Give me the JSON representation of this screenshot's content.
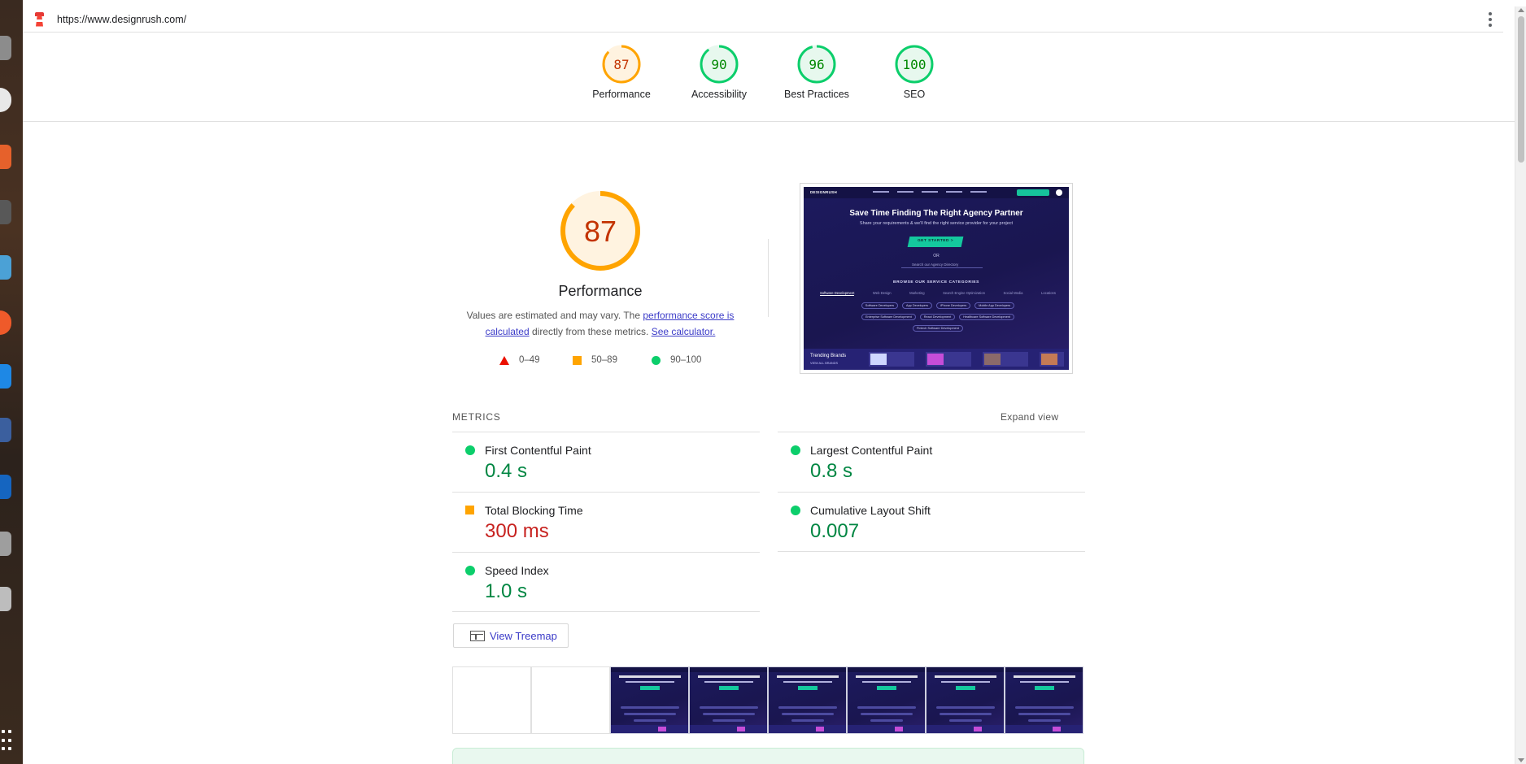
{
  "browser": {
    "url": "https://www.designrush.com/"
  },
  "categories": [
    {
      "name": "Performance",
      "score": 87,
      "color": "#ffa400",
      "text_color": "#c33300"
    },
    {
      "name": "Accessibility",
      "score": 90,
      "color": "#0cce6b",
      "text_color": "#008800"
    },
    {
      "name": "Best Practices",
      "score": 96,
      "color": "#0cce6b",
      "text_color": "#008800"
    },
    {
      "name": "SEO",
      "score": 100,
      "color": "#0cce6b",
      "text_color": "#008800"
    }
  ],
  "performance": {
    "score": 87,
    "title": "Performance",
    "desc_prefix": "Values are estimated and may vary. The ",
    "desc_link1": "performance score is calculated",
    "desc_middle": " directly from these metrics. ",
    "desc_link2": "See calculator.",
    "legend": [
      {
        "shape": "triangle",
        "range": "0–49",
        "color": "#eb0f00"
      },
      {
        "shape": "square",
        "range": "50–89",
        "color": "#ffa400"
      },
      {
        "shape": "circle",
        "range": "90–100",
        "color": "#0cce6b"
      }
    ]
  },
  "screenshot": {
    "logo": "DESIGNRUSH",
    "headline": "Save Time Finding The Right Agency Partner",
    "subline": "Share your requirements & we'll find the right service provider for your project",
    "cta": "GET STARTED >",
    "or": "OR",
    "search_placeholder": "Search our Agency Directory",
    "browse": "BROWSE OUR SERVICE CATEGORIES",
    "tabs": [
      "Software Development",
      "Web Design",
      "Marketing",
      "Search Engine Optimization",
      "Social Media",
      "Locations"
    ],
    "chips_row1": [
      "Software Developers",
      "App Developers",
      "iPhone Developers",
      "Mobile App Developers"
    ],
    "chips_row2": [
      "Enterprise Software Development",
      "React Development",
      "Healthcare Software Development"
    ],
    "chips_row3": [
      "Fintech Software Development"
    ],
    "footer_title": "Trending Brands",
    "footer_sub": "VIEW ALL BRANDS"
  },
  "metrics": {
    "label": "METRICS",
    "expand": "Expand view",
    "items": [
      {
        "name": "First Contentful Paint",
        "value": "0.4 s",
        "status": "pass"
      },
      {
        "name": "Largest Contentful Paint",
        "value": "0.8 s",
        "status": "pass"
      },
      {
        "name": "Total Blocking Time",
        "value": "300 ms",
        "status": "average"
      },
      {
        "name": "Cumulative Layout Shift",
        "value": "0.007",
        "status": "pass"
      },
      {
        "name": "Speed Index",
        "value": "1.0 s",
        "status": "pass"
      }
    ]
  },
  "treemap": {
    "label": "View Treemap"
  },
  "filmstrip": {
    "frames": [
      "blank",
      "blank",
      "loaded",
      "loaded",
      "loaded",
      "loaded",
      "loaded",
      "loaded"
    ]
  }
}
